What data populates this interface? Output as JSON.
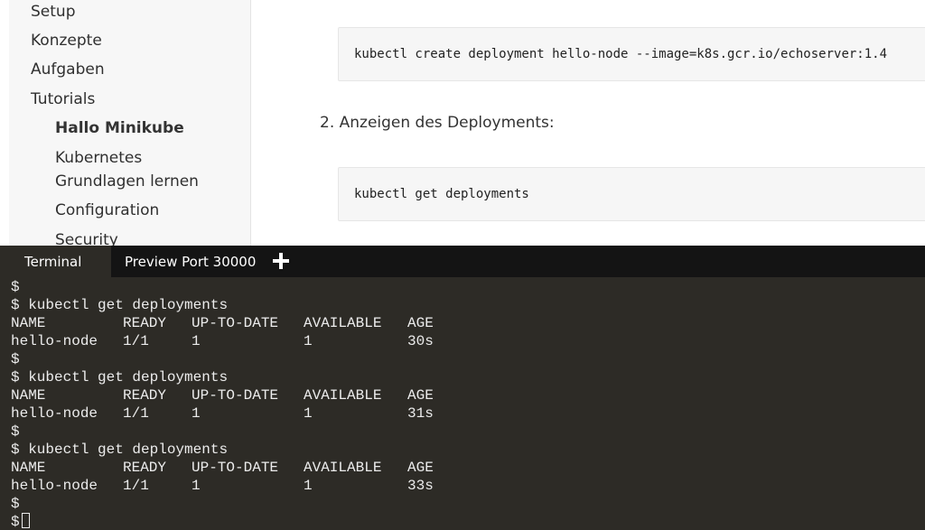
{
  "sidebar": {
    "items": [
      {
        "label": "Setup"
      },
      {
        "label": "Konzepte"
      },
      {
        "label": "Aufgaben"
      },
      {
        "label": "Tutorials"
      },
      {
        "label": "Hallo Minikube"
      },
      {
        "label": "Kubernetes"
      },
      {
        "label": "Grundlagen lernen"
      },
      {
        "label": "Configuration"
      },
      {
        "label": "Security"
      }
    ]
  },
  "content": {
    "code1": "kubectl create deployment hello-node --image=k8s.gcr.io/echoserver:1.4",
    "step2": "2. Anzeigen des Deployments:",
    "code2": "kubectl get deployments"
  },
  "terminal": {
    "tabs": [
      {
        "label": "Terminal"
      },
      {
        "label": "Preview Port 30000"
      }
    ],
    "prompt": "$",
    "command": "$ kubectl get deployments",
    "headers": [
      "NAME",
      "READY",
      "UP-TO-DATE",
      "AVAILABLE",
      "AGE"
    ],
    "blocks": [
      {
        "row": [
          "hello-node",
          "1/1",
          "1",
          "1",
          "30s"
        ]
      },
      {
        "row": [
          "hello-node",
          "1/1",
          "1",
          "1",
          "31s"
        ]
      },
      {
        "row": [
          "hello-node",
          "1/1",
          "1",
          "1",
          "33s"
        ]
      }
    ]
  }
}
